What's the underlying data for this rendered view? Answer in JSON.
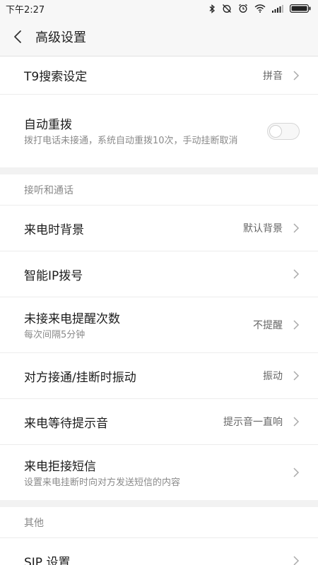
{
  "status": {
    "time": "下午2:27"
  },
  "header": {
    "title": "高级设置"
  },
  "top_group": {
    "t9": {
      "label": "T9搜索设定",
      "value": "拼音"
    },
    "redial": {
      "label": "自动重拨",
      "sub": "拨打电话未接通，系统自动重拨10次，手动挂断取消",
      "enabled": false
    }
  },
  "section_calls": {
    "header": "接听和通话",
    "items": [
      {
        "label": "来电时背景",
        "value": "默认背景"
      },
      {
        "label": "智能IP拨号"
      },
      {
        "label": "未接来电提醒次数",
        "sub": "每次间隔5分钟",
        "value": "不提醒"
      },
      {
        "label": "对方接通/挂断时振动",
        "value": "振动"
      },
      {
        "label": "来电等待提示音",
        "value": "提示音一直响"
      },
      {
        "label": "来电拒接短信",
        "sub": "设置来电挂断时向对方发送短信的内容"
      }
    ]
  },
  "section_other": {
    "header": "其他",
    "items": [
      {
        "label": "SIP 设置"
      }
    ]
  },
  "icons": {
    "status": [
      "bluetooth-icon",
      "alarm-off-icon",
      "alarm-clock-icon",
      "wifi-icon",
      "signal-icon",
      "battery-icon"
    ],
    "back": "back-arrow-icon",
    "chevron": "chevron-right-icon"
  }
}
